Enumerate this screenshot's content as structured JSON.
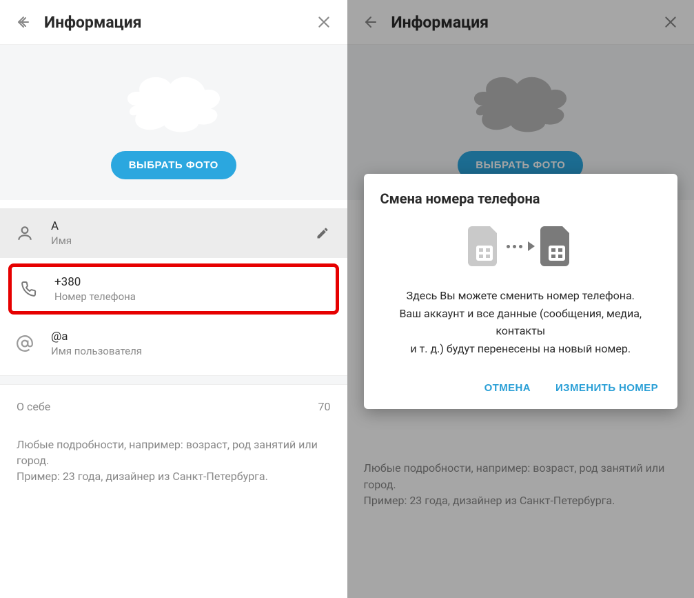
{
  "left": {
    "header": {
      "title": "Информация"
    },
    "choose_photo": "ВЫБРАТЬ ФОТО",
    "name": {
      "value": "А",
      "label": "Имя"
    },
    "phone": {
      "value": "+380",
      "label": "Номер телефона"
    },
    "username": {
      "value": "@а",
      "label": "Имя пользователя"
    },
    "bio": {
      "title": "О себе",
      "count": "70",
      "line1": "Любые подробности, например: возраст, род занятий или город.",
      "line2": "Пример: 23 года, дизайнер из Санкт-Петербурга."
    }
  },
  "right": {
    "header": {
      "title": "Информация"
    },
    "choose_photo": "ВЫБРАТЬ ФОТО",
    "bio": {
      "line1": "Любые подробности, например: возраст, род занятий или город.",
      "line2": "Пример: 23 года, дизайнер из Санкт-Петербурга."
    },
    "modal": {
      "title": "Смена номера телефона",
      "body_l1": "Здесь Вы можете сменить номер телефона.",
      "body_l2": "Ваш аккаунт и все данные (сообщения, медиа, контакты",
      "body_l3": "и т. д.) будут перенесены на новый номер.",
      "cancel": "ОТМЕНА",
      "confirm": "ИЗМЕНИТЬ НОМЕР"
    }
  }
}
